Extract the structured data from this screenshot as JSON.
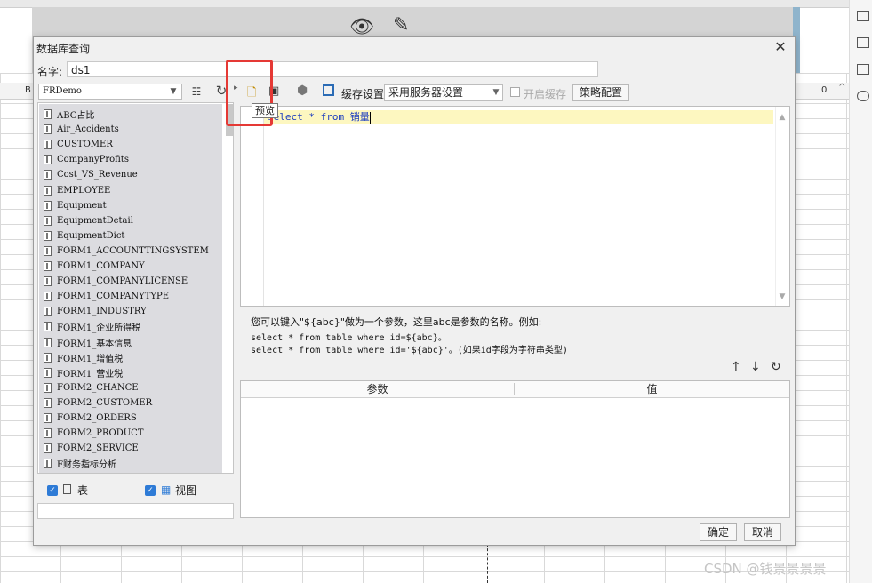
{
  "background": {
    "cell_label_b": "B",
    "cell_label_0": "0",
    "watermark": "CSDN @钱景景景景"
  },
  "dialog": {
    "title": "数据库查询",
    "close_glyph": "✕",
    "name_label": "名字:",
    "name_value": "ds1"
  },
  "left_panel": {
    "database": "FRDemo",
    "tables": [
      "ABC占比",
      "Air_Accidents",
      "CUSTOMER",
      "CompanyProfits",
      "Cost_VS_Revenue",
      "EMPLOYEE",
      "Equipment",
      "EquipmentDetail",
      "EquipmentDict",
      "FORM1_ACCOUNTTINGSYSTEM",
      "FORM1_COMPANY",
      "FORM1_COMPANYLICENSE",
      "FORM1_COMPANYTYPE",
      "FORM1_INDUSTRY",
      "FORM1_企业所得税",
      "FORM1_基本信息",
      "FORM1_增值税",
      "FORM1_营业税",
      "FORM2_CHANCE",
      "FORM2_CUSTOMER",
      "FORM2_ORDERS",
      "FORM2_PRODUCT",
      "FORM2_SERVICE",
      "F财务指标分析"
    ],
    "filter_table_label": "表",
    "filter_view_label": "视图"
  },
  "toolbar": {
    "preview_tooltip": "预览",
    "cache_label": "缓存设置",
    "cache_option": "采用服务器设置",
    "open_cache_label": "开启缓存",
    "policy_button": "策略配置"
  },
  "editor": {
    "sql": "select * from 销量"
  },
  "hint": {
    "line1": "您可以键入\"${abc}\"做为一个参数，这里abc是参数的名称。例如:",
    "line2": "select * from table where id=${abc}。",
    "line3": "select * from table where id='${abc}'。(如果id字段为字符串类型)"
  },
  "params": {
    "col_param": "参数",
    "col_value": "值"
  },
  "footer": {
    "ok": "确定",
    "cancel": "取消"
  }
}
